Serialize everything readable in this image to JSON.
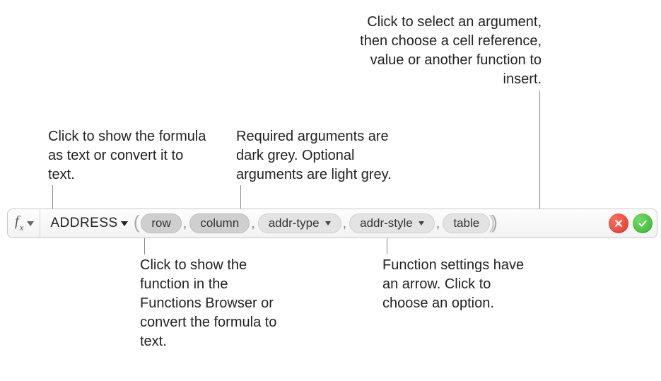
{
  "callouts": {
    "fx": "Click to show the formula as text or convert it to text.",
    "required_optional": "Required arguments are dark grey. Optional arguments are light grey.",
    "select_arg": "Click to select an argument, then choose a cell reference, value or another function to insert.",
    "fn_browser": "Click to show the function in the Functions Browser or convert the formula to text.",
    "settings_arrow": "Function settings have an arrow. Click to choose an option."
  },
  "formula": {
    "fx_symbol": "f",
    "fx_sub": "x",
    "function_name": "ADDRESS",
    "args": {
      "row": "row",
      "column": "column",
      "addr_type": "addr-type",
      "addr_style": "addr-style",
      "table": "table"
    }
  }
}
